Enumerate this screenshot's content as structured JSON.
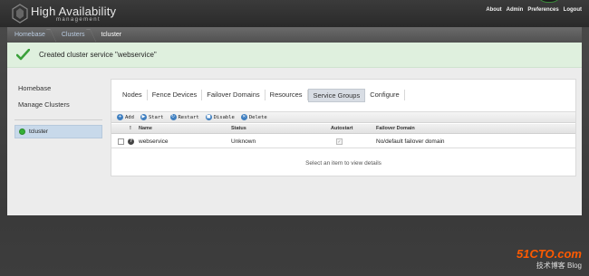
{
  "app": {
    "title": "High Availability",
    "subtitle": "management"
  },
  "top_links": [
    "About",
    "Admin",
    "Preferences",
    "Logout"
  ],
  "breadcrumb": [
    "Homebase",
    "Clusters",
    "tcluster"
  ],
  "notice": {
    "message": "Created cluster service \"webservice\"",
    "color": "#dff0de"
  },
  "sidebar": {
    "items": [
      "Homebase",
      "Manage Clusters"
    ],
    "cluster": "tcluster",
    "cluster_status_color": "#35b035"
  },
  "tabs": [
    {
      "label": "Nodes",
      "active": false
    },
    {
      "label": "Fence Devices",
      "active": false
    },
    {
      "label": "Failover Domains",
      "active": false
    },
    {
      "label": "Resources",
      "active": false
    },
    {
      "label": "Service Groups",
      "active": true
    },
    {
      "label": "Configure",
      "active": false
    }
  ],
  "toolbar": {
    "add": "Add",
    "start": "Start",
    "restart": "Restart",
    "disable": "Disable",
    "delete": "Delete"
  },
  "table": {
    "columns": [
      "!",
      "Name",
      "Status",
      "Autostart",
      "Failover Domain"
    ],
    "rows": [
      {
        "name": "webservice",
        "status": "Unknown",
        "autostart": true,
        "failover_domain": "No/default failover domain"
      }
    ]
  },
  "detail_hint": "Select an item to view details",
  "watermark": {
    "line1": "51CTO.com",
    "line2": "技术博客 Blog"
  }
}
